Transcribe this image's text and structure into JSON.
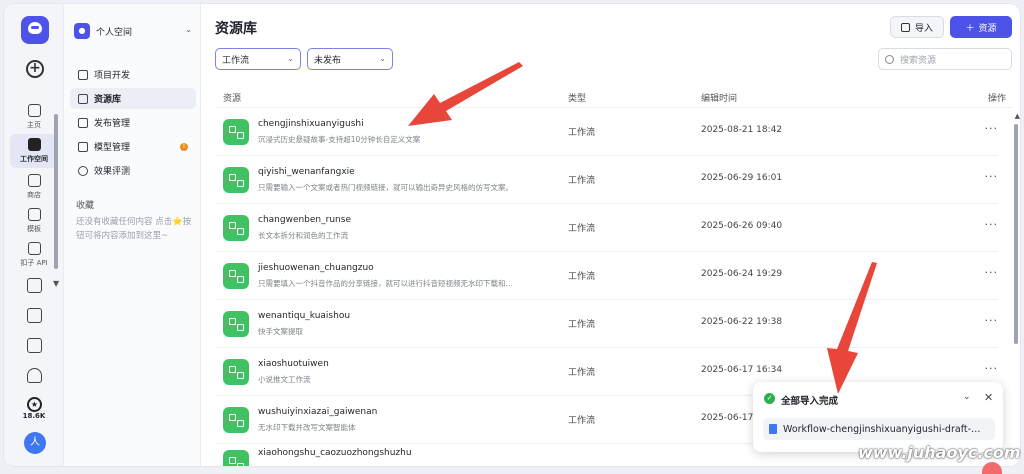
{
  "rail": {
    "items": [
      {
        "label": "主页"
      },
      {
        "label": "工作空间"
      },
      {
        "label": "商店"
      },
      {
        "label": "模板"
      },
      {
        "label": "扣子 API"
      }
    ],
    "count": "18.6K",
    "avatar": "人"
  },
  "sidebar": {
    "space": "个人空间",
    "nav": [
      {
        "label": "项目开发"
      },
      {
        "label": "资源库"
      },
      {
        "label": "发布管理"
      },
      {
        "label": "模型管理",
        "badge": "!"
      },
      {
        "label": "效果评测"
      }
    ],
    "favorites_title": "收藏",
    "favorites_tip": "还没有收藏任何内容 点击⭐按钮可将内容添加到这里~"
  },
  "header": {
    "title": "资源库",
    "import_label": "导入",
    "add_label": "资源"
  },
  "filters": {
    "type": "工作流",
    "status": "未发布",
    "search_placeholder": "搜索资源"
  },
  "table": {
    "columns": [
      "资源",
      "类型",
      "编辑时间",
      "操作"
    ],
    "rows": [
      {
        "name": "chengjinshixuanyigushi",
        "desc": "沉浸式历史悬疑故事-支持超10分钟长自定义文案",
        "type": "工作流",
        "time": "2025-08-21 18:42"
      },
      {
        "name": "qiyishi_wenanfangxie",
        "desc": "只需要输入一个文案或者热门视频链接，就可以输出奇异史风格的仿写文案。",
        "type": "工作流",
        "time": "2025-06-29 16:01"
      },
      {
        "name": "changwenben_runse",
        "desc": "长文本拆分和润色的工作流",
        "type": "工作流",
        "time": "2025-06-26 09:40"
      },
      {
        "name": "jieshuowenan_chuangzuo",
        "desc": "只需要填入一个抖音作品的分享链接，就可以进行抖音短视频无水印下载和…",
        "type": "工作流",
        "time": "2025-06-24 19:29"
      },
      {
        "name": "wenantiqu_kuaishou",
        "desc": "快手文案提取",
        "type": "工作流",
        "time": "2025-06-22 19:38"
      },
      {
        "name": "xiaoshuotuiwen",
        "desc": "小说推文工作流",
        "type": "工作流",
        "time": "2025-06-17 16:34"
      },
      {
        "name": "wushuiyinxiazai_gaiwenan",
        "desc": "无水印下载并改写文案智能体",
        "type": "工作流",
        "time": "2025-06-17 16:29"
      },
      {
        "name": "xiaohongshu_caozuozhongshuzhu",
        "desc": "",
        "type": "",
        "time": ""
      }
    ],
    "op_label": "···"
  },
  "toast": {
    "title": "全部导入完成",
    "file": "Workflow-chengjinshixuanyigushi-draft-…"
  },
  "watermark": "www.juhaoyc.com",
  "colors": {
    "accent": "#4d53e8",
    "resource_icon": "#3ec264",
    "annotation_arrow": "#e8463a",
    "success": "#2fb050"
  }
}
